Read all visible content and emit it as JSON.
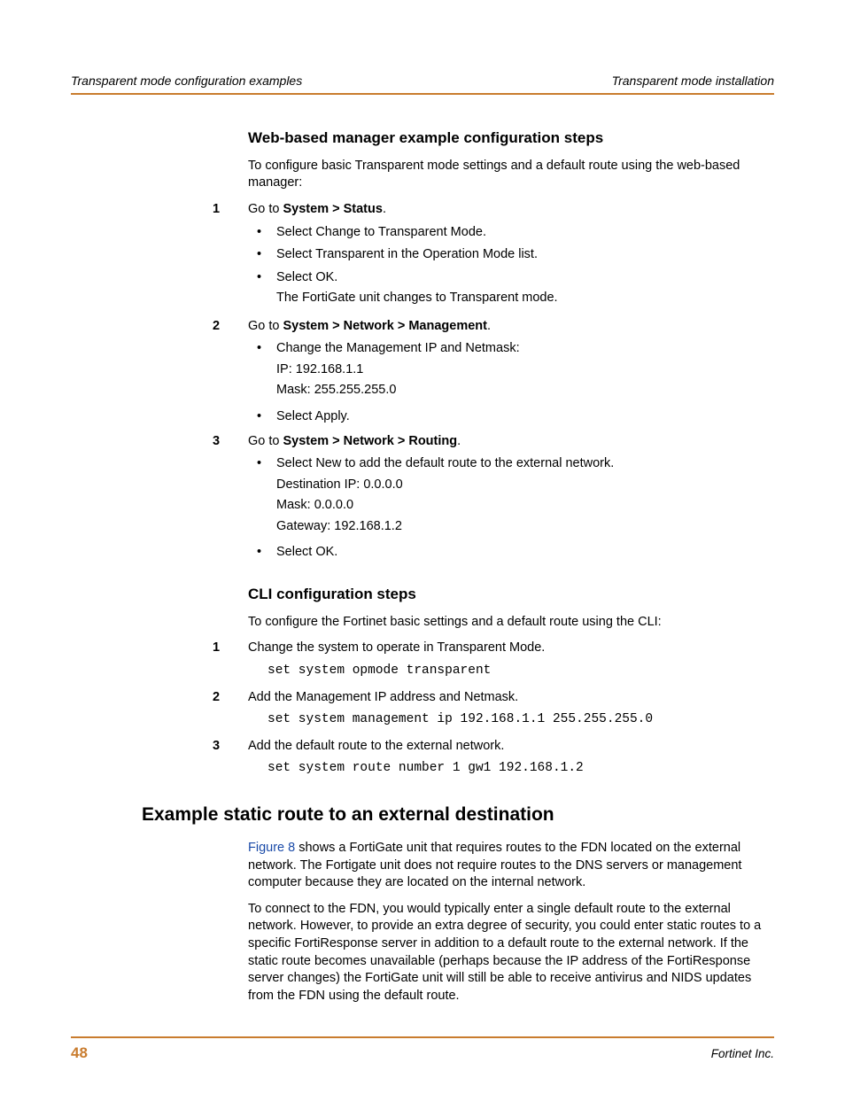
{
  "header": {
    "left": "Transparent mode configuration examples",
    "right": "Transparent mode installation"
  },
  "sec1": {
    "title": "Web-based manager example configuration steps",
    "intro": "To configure basic Transparent mode settings and a default route using the web-based manager:",
    "step1": {
      "num": "1",
      "prefix": "Go to ",
      "bold": "System > Status",
      "suffix": ".",
      "b1": "Select Change to Transparent Mode.",
      "b2": "Select Transparent in the Operation Mode list.",
      "b3": "Select OK.",
      "b3b": "The FortiGate unit changes to Transparent mode."
    },
    "step2": {
      "num": "2",
      "prefix": "Go to ",
      "bold": "System > Network > Management",
      "suffix": ".",
      "b1a": "Change the Management IP and Netmask:",
      "b1b": "IP: 192.168.1.1",
      "b1c": "Mask: 255.255.255.0",
      "b2": "Select Apply."
    },
    "step3": {
      "num": "3",
      "prefix": "Go to ",
      "bold": "System > Network > Routing",
      "suffix": ".",
      "b1a": "Select New to add the default route to the external network.",
      "b1b": "Destination IP: 0.0.0.0",
      "b1c": "Mask: 0.0.0.0",
      "b1d": "Gateway: 192.168.1.2",
      "b2": "Select OK."
    }
  },
  "sec2": {
    "title": "CLI configuration steps",
    "intro": "To configure the Fortinet basic settings and a default route using the CLI:",
    "s1": {
      "num": "1",
      "text": "Change the system to operate in Transparent Mode.",
      "code": "set system opmode transparent"
    },
    "s2": {
      "num": "2",
      "text": "Add the Management IP address and Netmask.",
      "code": "set system management ip 192.168.1.1 255.255.255.0"
    },
    "s3": {
      "num": "3",
      "text": "Add the default route to the external network.",
      "code": "set system route number 1 gw1 192.168.1.2"
    }
  },
  "sec3": {
    "title": "Example static route to an external destination",
    "link": "Figure 8",
    "p1_rest": " shows a FortiGate unit that requires routes to the FDN located on the external network. The Fortigate unit does not require routes to the DNS servers or management computer because they are located on the internal network.",
    "p2": "To connect to the FDN, you would typically enter a single default route to the external network. However, to provide an extra degree of security, you could enter static routes to a specific FortiResponse server in addition to a default route to the external network. If the static route becomes unavailable (perhaps because the IP address of the FortiResponse server changes) the FortiGate unit will still be able to receive antivirus and NIDS updates from the FDN using the default route."
  },
  "footer": {
    "page": "48",
    "right": "Fortinet Inc."
  }
}
